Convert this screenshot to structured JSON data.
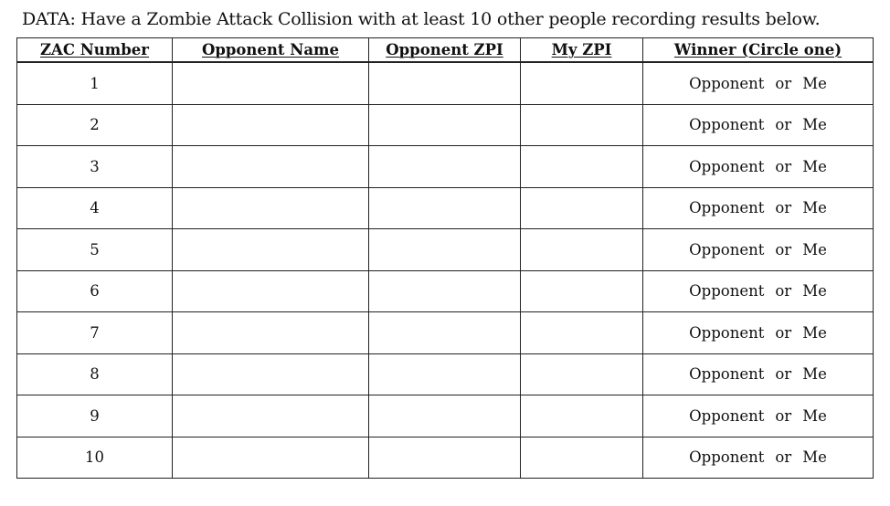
{
  "caption": "DATA: Have a Zombie Attack Collision with at least 10 other people recording results below.",
  "table": {
    "headers": [
      "ZAC Number",
      "Opponent Name",
      "Opponent ZPI",
      "My ZPI",
      "Winner (Circle one)"
    ],
    "rows": [
      {
        "zac": "1",
        "opponent_name": "",
        "opponent_zpi": "",
        "my_zpi": "",
        "winner_a": "Opponent",
        "winner_or": "or",
        "winner_b": "Me"
      },
      {
        "zac": "2",
        "opponent_name": "",
        "opponent_zpi": "",
        "my_zpi": "",
        "winner_a": "Opponent",
        "winner_or": "or",
        "winner_b": "Me"
      },
      {
        "zac": "3",
        "opponent_name": "",
        "opponent_zpi": "",
        "my_zpi": "",
        "winner_a": "Opponent",
        "winner_or": "or",
        "winner_b": "Me"
      },
      {
        "zac": "4",
        "opponent_name": "",
        "opponent_zpi": "",
        "my_zpi": "",
        "winner_a": "Opponent",
        "winner_or": "or",
        "winner_b": "Me"
      },
      {
        "zac": "5",
        "opponent_name": "",
        "opponent_zpi": "",
        "my_zpi": "",
        "winner_a": "Opponent",
        "winner_or": "or",
        "winner_b": "Me"
      },
      {
        "zac": "6",
        "opponent_name": "",
        "opponent_zpi": "",
        "my_zpi": "",
        "winner_a": "Opponent",
        "winner_or": "or",
        "winner_b": "Me"
      },
      {
        "zac": "7",
        "opponent_name": "",
        "opponent_zpi": "",
        "my_zpi": "",
        "winner_a": "Opponent",
        "winner_or": "or",
        "winner_b": "Me"
      },
      {
        "zac": "8",
        "opponent_name": "",
        "opponent_zpi": "",
        "my_zpi": "",
        "winner_a": "Opponent",
        "winner_or": "or",
        "winner_b": "Me"
      },
      {
        "zac": "9",
        "opponent_name": "",
        "opponent_zpi": "",
        "my_zpi": "",
        "winner_a": "Opponent",
        "winner_or": "or",
        "winner_b": "Me"
      },
      {
        "zac": "10",
        "opponent_name": "",
        "opponent_zpi": "",
        "my_zpi": "",
        "winner_a": "Opponent",
        "winner_or": "or",
        "winner_b": "Me"
      }
    ]
  }
}
